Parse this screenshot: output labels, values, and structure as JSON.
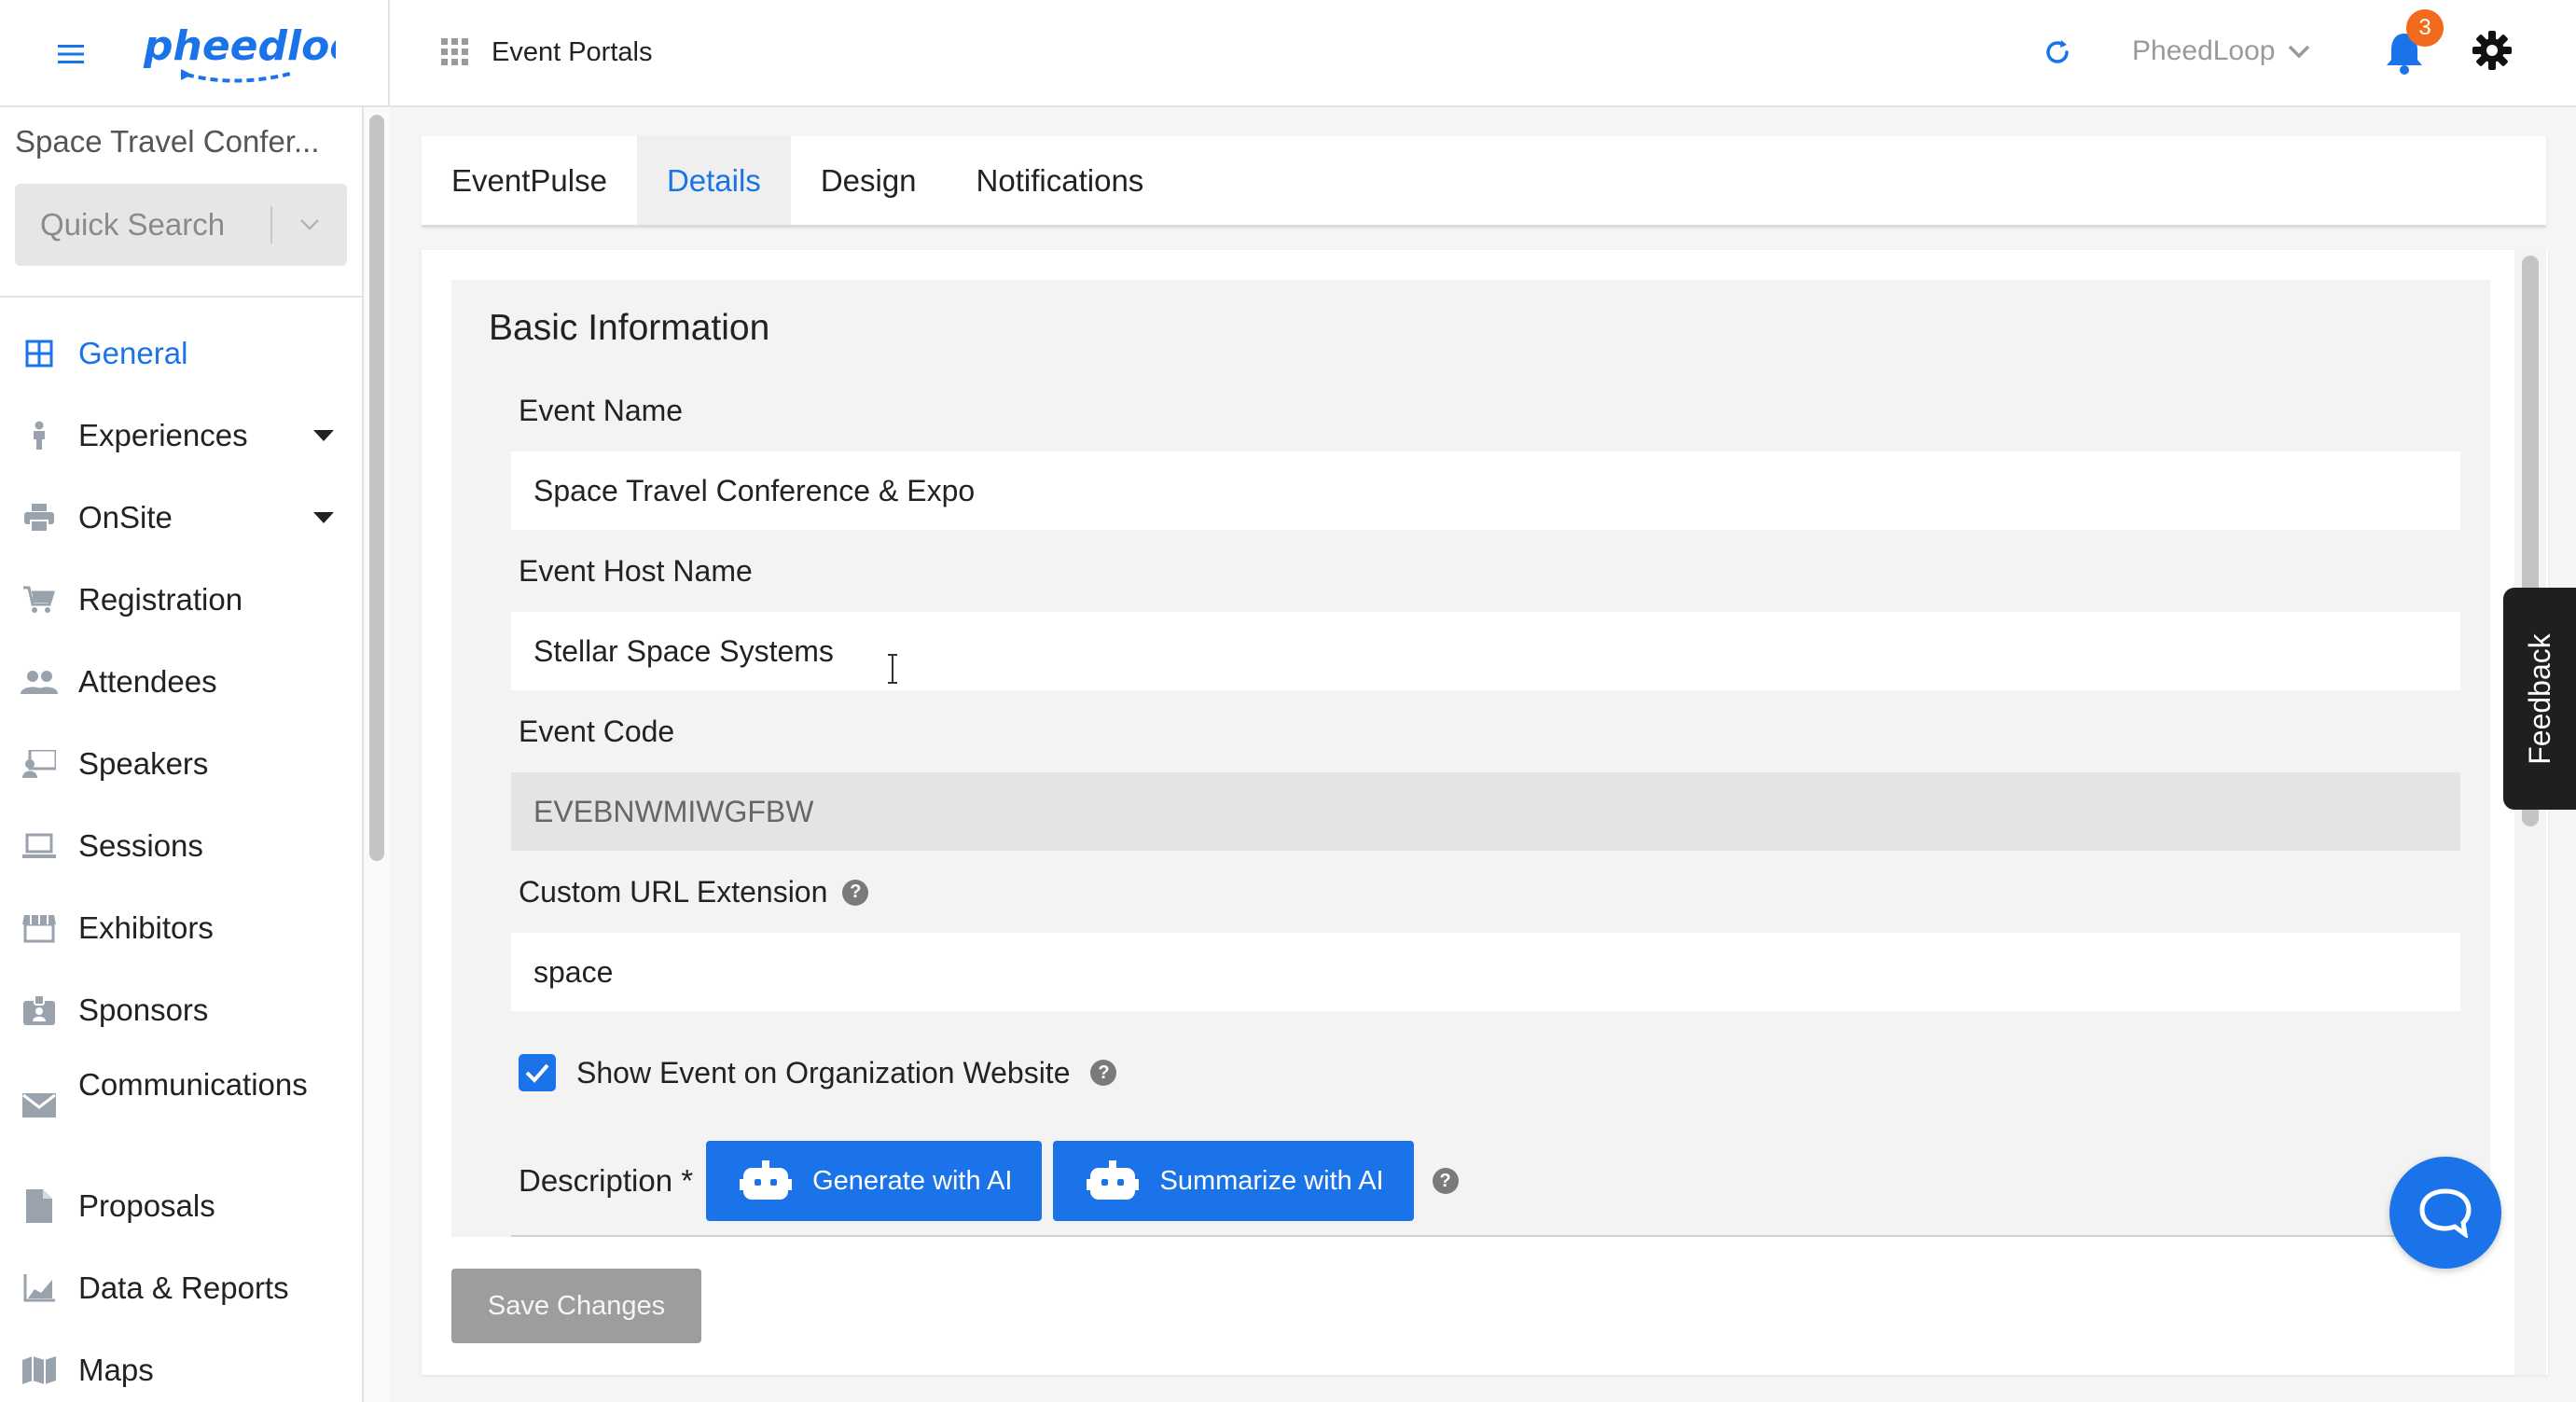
{
  "app": {
    "logo_text": "pheedloop",
    "portal_menu_label": "Event Portals",
    "org_name": "PheedLoop",
    "notification_count": "3",
    "accent_color": "#1a73e8",
    "badge_color": "#f26a1b"
  },
  "sidebar": {
    "event_name": "Space Travel Confer...",
    "quick_search_label": "Quick Search",
    "items": [
      {
        "label": "General",
        "icon": "grid-icon",
        "active": true
      },
      {
        "label": "Experiences",
        "icon": "person-icon",
        "has_caret": true
      },
      {
        "label": "OnSite",
        "icon": "printer-icon",
        "has_caret": true
      },
      {
        "label": "Registration",
        "icon": "cart-icon"
      },
      {
        "label": "Attendees",
        "icon": "people-icon"
      },
      {
        "label": "Speakers",
        "icon": "presenter-icon"
      },
      {
        "label": "Sessions",
        "icon": "laptop-icon"
      },
      {
        "label": "Exhibitors",
        "icon": "storefront-icon"
      },
      {
        "label": "Sponsors",
        "icon": "badge-icon"
      },
      {
        "label": "Communications",
        "icon": "mail-icon"
      },
      {
        "label": "Proposals",
        "icon": "document-icon"
      },
      {
        "label": "Data & Reports",
        "icon": "chart-icon"
      },
      {
        "label": "Maps",
        "icon": "map-icon"
      }
    ]
  },
  "tabs": [
    {
      "label": "EventPulse"
    },
    {
      "label": "Details",
      "active": true
    },
    {
      "label": "Design"
    },
    {
      "label": "Notifications"
    }
  ],
  "form": {
    "section_title": "Basic Information",
    "event_name_label": "Event Name",
    "event_name_value": "Space Travel Conference & Expo",
    "host_name_label": "Event Host Name",
    "host_name_value": "Stellar Space Systems",
    "event_code_label": "Event Code",
    "event_code_value": "EVEBNWMIWGFBW",
    "url_ext_label": "Custom URL Extension",
    "url_ext_value": "space",
    "show_on_org_label": "Show Event on Organization Website",
    "show_on_org_checked": true,
    "description_label": "Description *",
    "generate_ai_label": "Generate with AI",
    "summarize_ai_label": "Summarize with AI",
    "save_label": "Save Changes"
  },
  "feedback_label": "Feedback",
  "help_glyph": "?"
}
